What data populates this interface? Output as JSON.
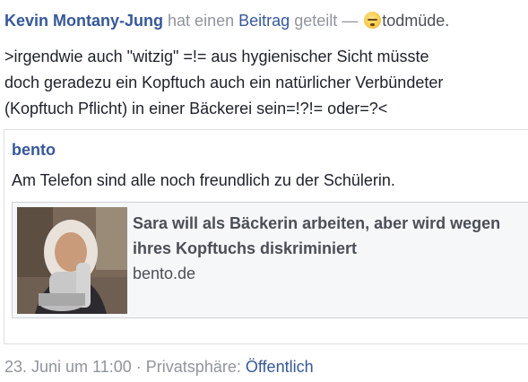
{
  "header": {
    "author": "Kevin Montany-Jung",
    "action_before": "hat einen",
    "object": "Beitrag",
    "action_after": "geteilt —",
    "feeling_icon": "sleepy-face-emoji",
    "feeling": "todmüde."
  },
  "post": {
    "message_lines": [
      ">irgendwie auch \"witzig\" =!= aus hygienischer Sicht müsste",
      "doch geradezu ein Kopftuch auch ein natürlicher Verbündeter",
      "(Kopftuch Pflicht)  in einer Bäckerei sein=!?!= oder=?<"
    ]
  },
  "shared": {
    "author": "bento",
    "text": "Am Telefon sind alle noch freundlich zu der Schülerin.",
    "link": {
      "title": "Sara will als Bäckerin arbeiten, aber wird wegen ihres Kopftuchs diskriminiert",
      "domain": "bento.de"
    }
  },
  "footer": {
    "date": "23. Juni um 11:00",
    "separator": "·",
    "privacy_label": "Privatsphäre:",
    "privacy_value": "Öffentlich"
  },
  "colors": {
    "link_blue": "#365899",
    "text": "#1d2129",
    "meta_gray": "#90949c",
    "border": "#dddfe2"
  }
}
